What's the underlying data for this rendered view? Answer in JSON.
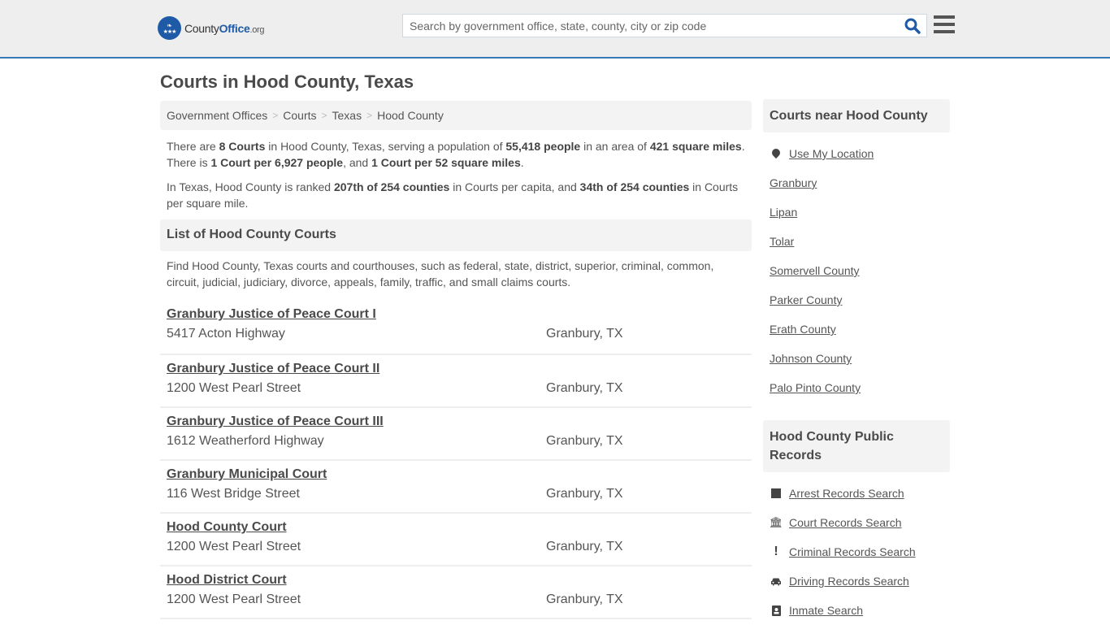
{
  "header": {
    "logo": {
      "brand_main": "County",
      "brand_accent": "Office",
      "brand_tld": ".org"
    },
    "search": {
      "placeholder": "Search by government office, state, county, city or zip code",
      "value": ""
    },
    "icons": {
      "search": "search-icon",
      "menu": "hamburger-menu-icon"
    }
  },
  "page": {
    "title": "Courts in Hood County, Texas"
  },
  "breadcrumb": [
    {
      "label": "Government Offices"
    },
    {
      "label": "Courts"
    },
    {
      "label": "Texas"
    },
    {
      "label": "Hood County"
    }
  ],
  "breadcrumb_separator": ">",
  "intro": {
    "p1": {
      "t1": "There are ",
      "b1": "8 Courts",
      "t2": " in Hood County, Texas, serving a population of ",
      "b2": "55,418 people",
      "t3": " in an area of ",
      "b3": "421 square miles",
      "t4": ". There is ",
      "b4": "1 Court per 6,927 people",
      "t5": ", and ",
      "b5": "1 Court per 52 square miles",
      "t6": "."
    },
    "p2": {
      "t1": "In Texas, Hood County is ranked ",
      "b1": "207th of 254 counties",
      "t2": " in Courts per capita, and ",
      "b2": "34th of 254 counties",
      "t3": " in Courts per square mile."
    }
  },
  "list_section": {
    "title": "List of Hood County Courts",
    "description": "Find Hood County, Texas courts and courthouses, such as federal, state, district, superior, criminal, common, circuit, judicial, judiciary, divorce, appeals, family, traffic, and small claims courts."
  },
  "courts": [
    {
      "name": "Granbury Justice of Peace Court I",
      "address": "5417 Acton Highway",
      "city": "Granbury, TX"
    },
    {
      "name": "Granbury Justice of Peace Court II",
      "address": "1200 West Pearl Street",
      "city": "Granbury, TX"
    },
    {
      "name": "Granbury Justice of Peace Court III",
      "address": "1612 Weatherford Highway",
      "city": "Granbury, TX"
    },
    {
      "name": "Granbury Municipal Court",
      "address": "116 West Bridge Street",
      "city": "Granbury, TX"
    },
    {
      "name": "Hood County Court",
      "address": "1200 West Pearl Street",
      "city": "Granbury, TX"
    },
    {
      "name": "Hood District Court",
      "address": "1200 West Pearl Street",
      "city": "Granbury, TX"
    }
  ],
  "sidebar": {
    "nearby": {
      "title": "Courts near Hood County",
      "use_location": "Use My Location",
      "links": [
        "Granbury",
        "Lipan",
        "Tolar",
        "Somervell County",
        "Parker County",
        "Erath County",
        "Johnson County",
        "Palo Pinto County"
      ]
    },
    "records": {
      "title": "Hood County Public Records",
      "links": [
        {
          "label": "Arrest Records Search",
          "icon": "arrest-square-icon"
        },
        {
          "label": "Court Records Search",
          "icon": "courthouse-icon"
        },
        {
          "label": "Criminal Records Search",
          "icon": "exclamation-icon"
        },
        {
          "label": "Driving Records Search",
          "icon": "car-icon"
        },
        {
          "label": "Inmate Search",
          "icon": "id-badge-icon"
        }
      ]
    }
  },
  "colors": {
    "accent": "#3478b4",
    "brand_blue": "#1f5aa6",
    "panel_bg": "#f3f3f3",
    "topbar_bg": "#eeeeee",
    "text": "#555555"
  }
}
